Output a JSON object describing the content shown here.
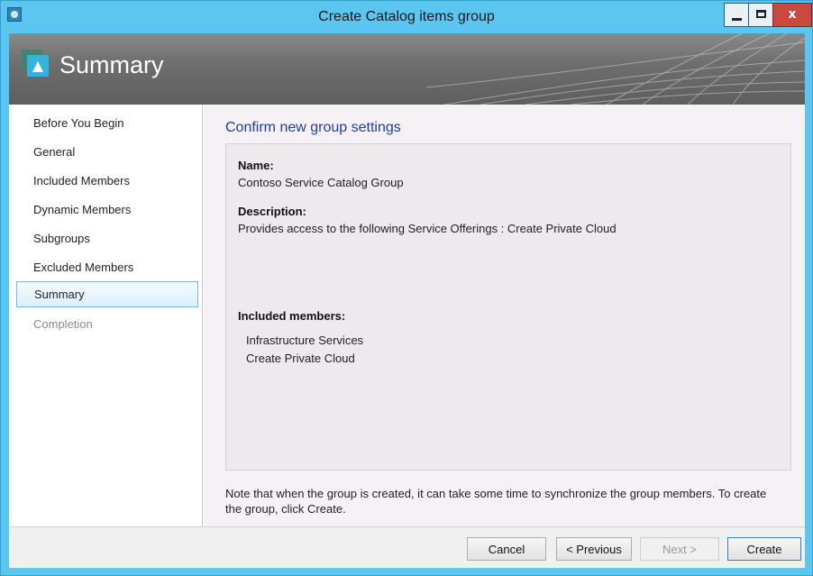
{
  "window": {
    "title": "Create Catalog items group",
    "controls": {
      "minimize": "minimize",
      "maximize": "maximize",
      "close": "x"
    }
  },
  "banner": {
    "title": "Summary",
    "icon": "wizard-icon"
  },
  "nav": {
    "items": [
      {
        "label": "Before You Begin",
        "state": "normal"
      },
      {
        "label": "General",
        "state": "normal"
      },
      {
        "label": "Included Members",
        "state": "normal"
      },
      {
        "label": "Dynamic Members",
        "state": "normal"
      },
      {
        "label": "Subgroups",
        "state": "normal"
      },
      {
        "label": "Excluded Members",
        "state": "normal"
      },
      {
        "label": "Summary",
        "state": "selected"
      },
      {
        "label": "Completion",
        "state": "disabled"
      }
    ]
  },
  "main": {
    "heading": "Confirm new group settings",
    "name_label": "Name:",
    "name_value": "Contoso Service Catalog Group",
    "description_label": "Description:",
    "description_value": "Provides access to the following Service Offerings :  Create Private Cloud",
    "members_label": "Included members:",
    "members": [
      "Infrastructure Services",
      "Create Private Cloud"
    ],
    "note": "Note that when the group is created, it can take some time to synchronize the group members. To create the group, click Create."
  },
  "footer": {
    "cancel": "Cancel",
    "previous": "< Previous",
    "next": "Next >",
    "create": "Create"
  },
  "colors": {
    "titlebar": "#5bc6f0",
    "heading": "#1f3ca8",
    "close_button": "#c9483f"
  }
}
